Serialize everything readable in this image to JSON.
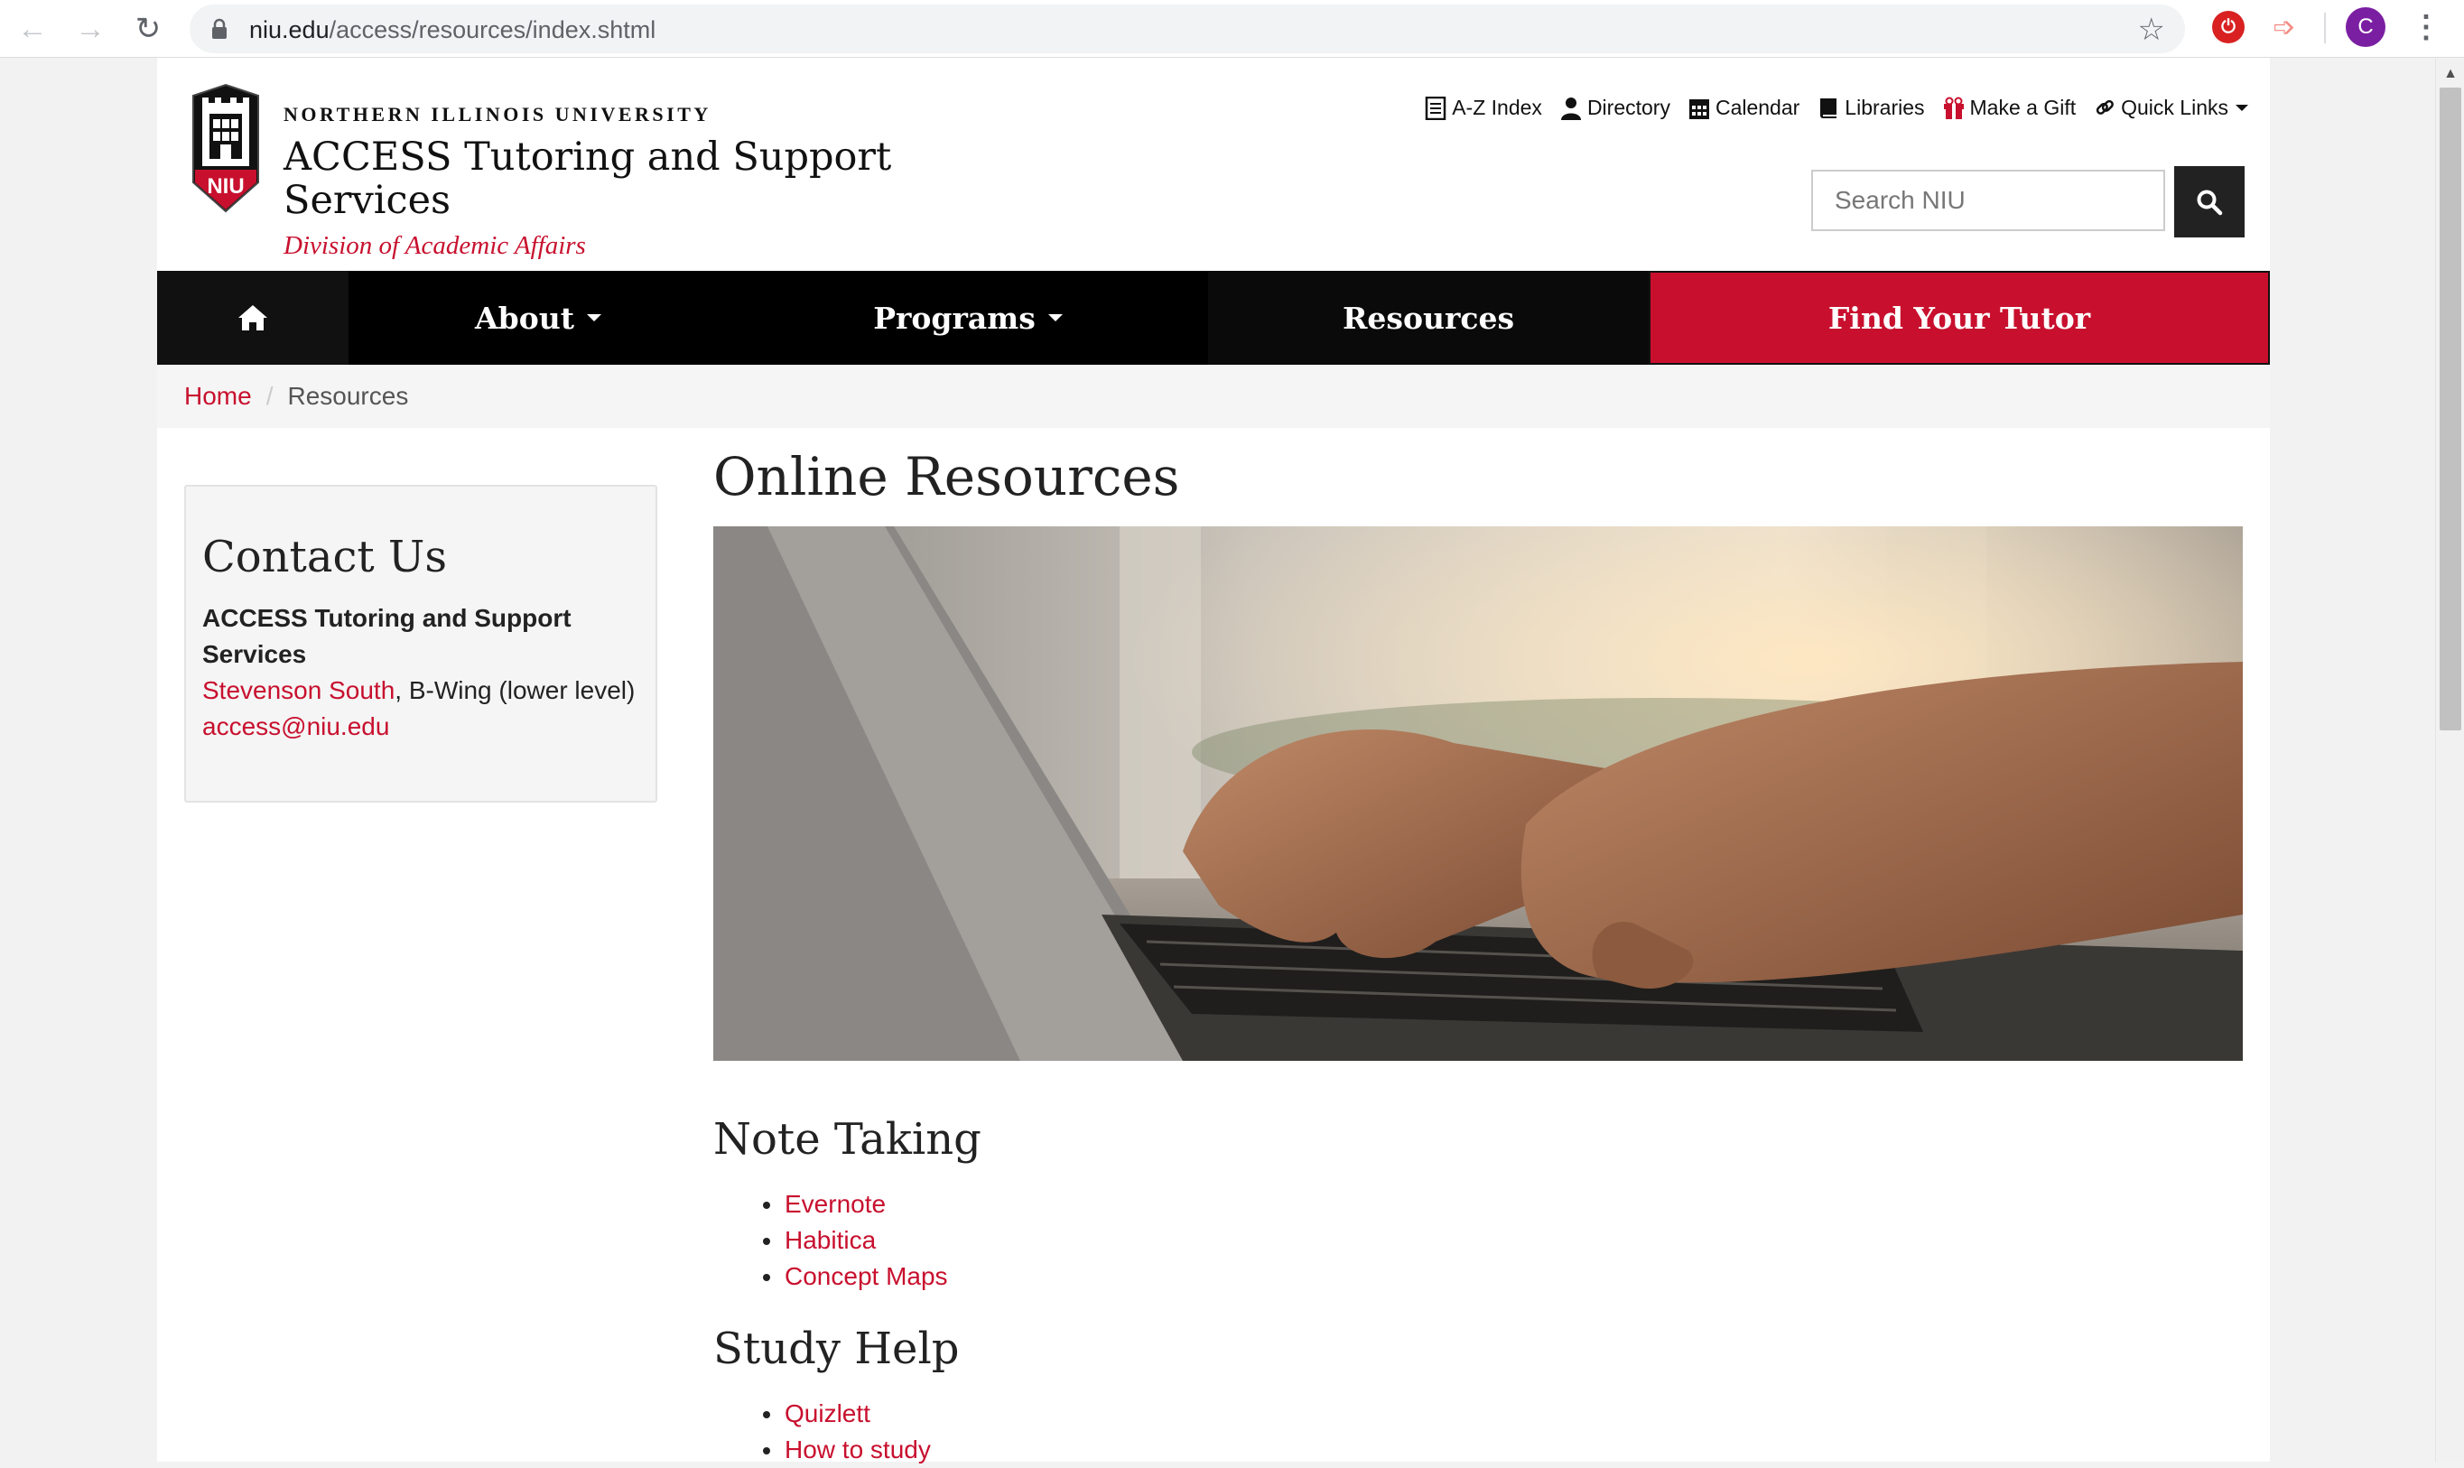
{
  "browser": {
    "url_domain": "niu.edu",
    "url_path": "/access/resources/index.shtml",
    "profile_initial": "C",
    "ext1_label": "⏻",
    "ext2_label": "➩"
  },
  "header": {
    "university": "NORTHERN ILLINOIS UNIVERSITY",
    "site_title": "ACCESS Tutoring and Support Services",
    "division": "Division of Academic Affairs",
    "logo_text": "NIU",
    "utility_links": [
      {
        "label": "A-Z Index",
        "icon": "list-icon"
      },
      {
        "label": "Directory",
        "icon": "person-icon"
      },
      {
        "label": "Calendar",
        "icon": "calendar-icon"
      },
      {
        "label": "Libraries",
        "icon": "book-icon"
      },
      {
        "label": "Make a Gift",
        "icon": "gift-icon"
      },
      {
        "label": "Quick Links",
        "icon": "link-icon"
      }
    ],
    "search_placeholder": "Search NIU"
  },
  "nav": {
    "about": "About",
    "programs": "Programs",
    "resources": "Resources",
    "find_tutor": "Find Your Tutor"
  },
  "breadcrumb": {
    "home": "Home",
    "separator": "/",
    "current": "Resources"
  },
  "sidebar": {
    "title": "Contact Us",
    "org": "ACCESS Tutoring and Support Services",
    "location_link": "Stevenson South",
    "location_rest": ", B-Wing (lower level)",
    "email": "access@niu.edu"
  },
  "main": {
    "title": "Online Resources",
    "sections": [
      {
        "heading": "Note Taking",
        "items": [
          "Evernote",
          "Habitica",
          "Concept Maps"
        ]
      },
      {
        "heading": "Study Help",
        "items": [
          "Quizlett",
          "How to study"
        ]
      }
    ]
  },
  "colors": {
    "brand_red": "#c8102e",
    "nav_black": "#000000"
  }
}
